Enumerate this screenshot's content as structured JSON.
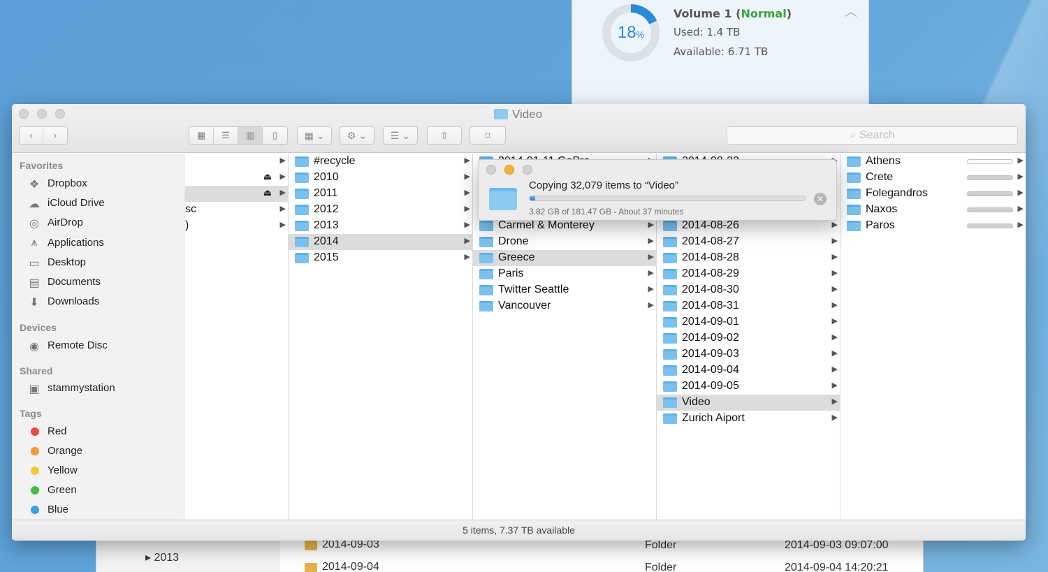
{
  "volume": {
    "percent": "18",
    "percent_sign": "%",
    "used_fraction": 0.18,
    "name_prefix": "Volume 1 (",
    "status": "Normal",
    "name_suffix": ")",
    "used": "Used: 1.4 TB",
    "available": "Available: 6.71 TB"
  },
  "bg_list": {
    "year": "2013",
    "rows": [
      {
        "name": "2014-09-03",
        "kind": "Folder",
        "date": "2014-09-03 09:07:00"
      },
      {
        "name": "2014-09-04",
        "kind": "Folder",
        "date": "2014-09-04 14:20:21"
      }
    ]
  },
  "window": {
    "title": "Video",
    "search_placeholder": "Search",
    "status": "5 items, 7.37 TB available"
  },
  "sidebar": {
    "favorites_label": "Favorites",
    "favorites": [
      {
        "label": "Dropbox",
        "icon": "dropbox-icon"
      },
      {
        "label": "iCloud Drive",
        "icon": "cloud-icon"
      },
      {
        "label": "AirDrop",
        "icon": "airdrop-icon"
      },
      {
        "label": "Applications",
        "icon": "applications-icon"
      },
      {
        "label": "Desktop",
        "icon": "desktop-icon"
      },
      {
        "label": "Documents",
        "icon": "documents-icon"
      },
      {
        "label": "Downloads",
        "icon": "downloads-icon"
      }
    ],
    "devices_label": "Devices",
    "devices": [
      {
        "label": "Remote Disc",
        "icon": "disc-icon"
      }
    ],
    "shared_label": "Shared",
    "shared": [
      {
        "label": "stammystation",
        "icon": "computer-icon"
      }
    ],
    "tags_label": "Tags",
    "tags": [
      {
        "label": "Red",
        "color": "#e74c3c"
      },
      {
        "label": "Orange",
        "color": "#f39c38"
      },
      {
        "label": "Yellow",
        "color": "#f2c834"
      },
      {
        "label": "Green",
        "color": "#4cb849"
      },
      {
        "label": "Blue",
        "color": "#3aa0e6"
      }
    ]
  },
  "columns": {
    "col1": [
      {
        "name": ""
      },
      {
        "name": "",
        "eject": true
      },
      {
        "name": "",
        "eject": true,
        "selected": true
      },
      {
        "name": "sc"
      },
      {
        "name": ")"
      }
    ],
    "col2": [
      "#recycle",
      "2010",
      "2011",
      "2012",
      "2013",
      "2014",
      "2015"
    ],
    "col2_selected": "2014",
    "col3": [
      "2014-01-11 GoPro",
      "",
      "",
      "",
      "Carmel & Monterey",
      "Drone",
      "Greece",
      "Paris",
      "Twitter Seattle",
      "Vancouver"
    ],
    "col3_selected": "Greece",
    "col4": [
      "2014-08-22",
      "",
      "",
      "",
      "2014-08-26",
      "2014-08-27",
      "2014-08-28",
      "2014-08-29",
      "2014-08-30",
      "2014-08-31",
      "2014-09-01",
      "2014-09-02",
      "2014-09-03",
      "2014-09-04",
      "2014-09-05",
      "Video",
      "Zurich Aiport"
    ],
    "col4_selected": "Video",
    "col5": [
      {
        "name": "Athens",
        "progress": 0.05
      },
      {
        "name": "Crete",
        "progress": 0
      },
      {
        "name": "Folegandros",
        "progress": 0
      },
      {
        "name": "Naxos",
        "progress": 0
      },
      {
        "name": "Paros",
        "progress": 0
      }
    ]
  },
  "copy_dialog": {
    "message": "Copying 32,079 items to “Video”",
    "detail": "3.82 GB of 181.47 GB - About 37 minutes",
    "progress": 0.021
  }
}
